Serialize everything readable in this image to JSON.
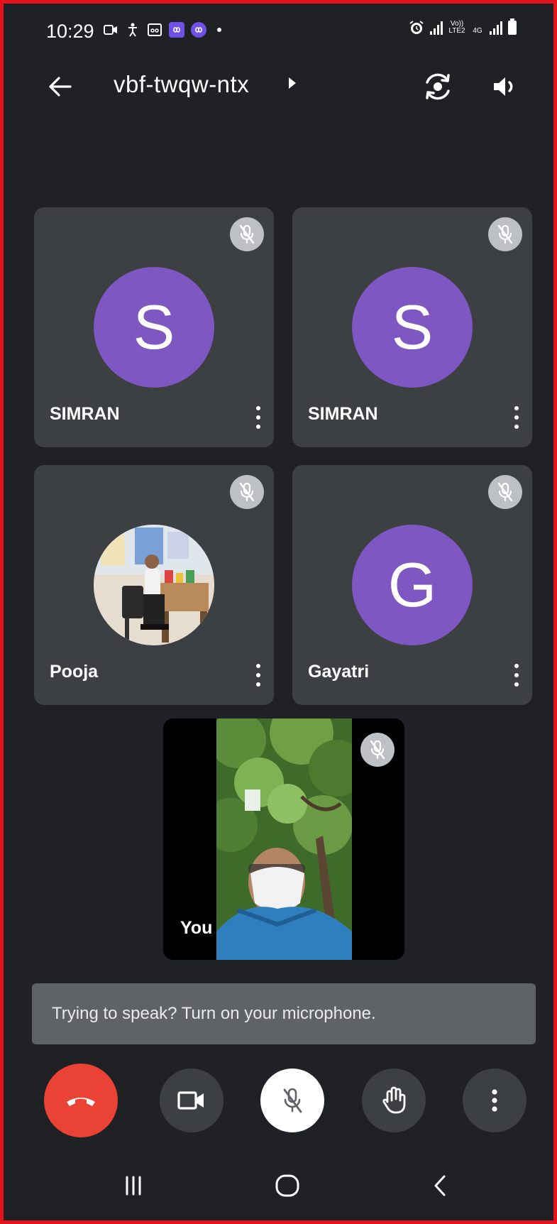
{
  "status_bar": {
    "time": "10:29",
    "sim1_label": "Vo)) LTE2",
    "sim2_label": "4G"
  },
  "header": {
    "meeting_code": "vbf-twqw-ntx"
  },
  "participants": [
    {
      "name": "SIMRAN",
      "initial": "S",
      "avatar_color": "#7e57c2",
      "muted": true
    },
    {
      "name": "SIMRAN",
      "initial": "S",
      "avatar_color": "#7e57c2",
      "muted": true
    },
    {
      "name": "Pooja",
      "initial": "",
      "avatar_type": "photo",
      "muted": true
    },
    {
      "name": "Gayatri",
      "initial": "G",
      "avatar_color": "#7e57c2",
      "muted": true
    }
  ],
  "self_view": {
    "name": "You",
    "muted": true
  },
  "prompt": {
    "text": "Trying to speak? Turn on your microphone."
  },
  "controls": {
    "end_call_icon": "phone-hangup-icon",
    "camera_icon": "videocam-icon",
    "mic_icon": "mic-off-icon",
    "raise_hand_icon": "hand-icon",
    "more_icon": "more-vert-icon"
  },
  "colors": {
    "background": "#202124",
    "tile": "#3c4043",
    "avatar": "#7e57c2",
    "end_call": "#ea4335",
    "prompt_bg": "#5f6368",
    "frame_border": "#e3121b"
  }
}
